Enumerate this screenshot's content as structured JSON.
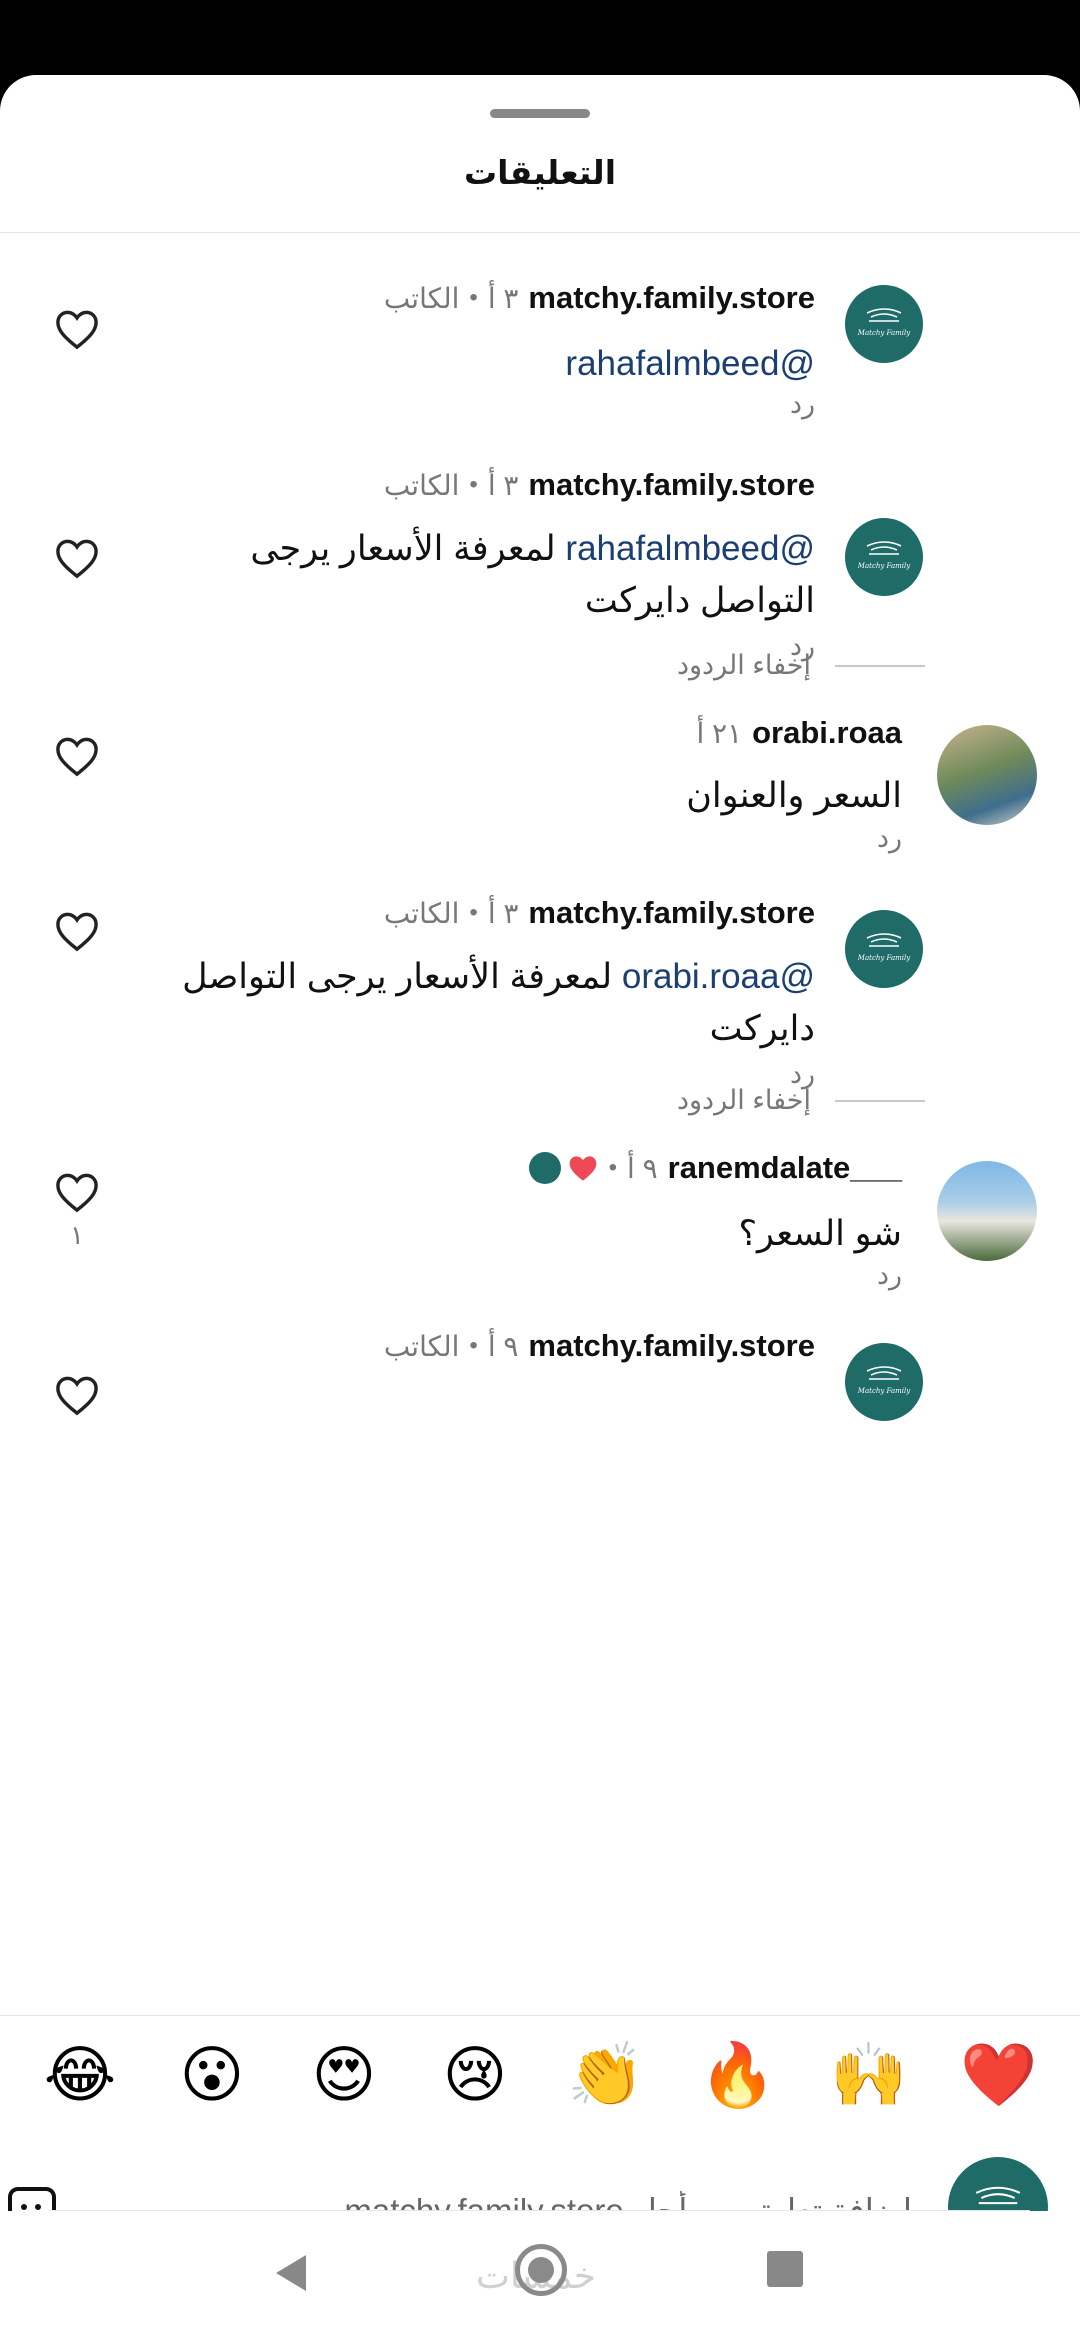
{
  "sheet": {
    "title": "التعليقات"
  },
  "comments": [
    {
      "username": "matchy.family.store",
      "time": "٣ أ",
      "author_badge": "الكاتب",
      "mention": "@rahafalmbeed",
      "text_line1": "",
      "text_line2": "",
      "reply": "رد"
    },
    {
      "username": "matchy.family.store",
      "time": "٣ أ",
      "author_badge": "الكاتب",
      "mention": "@rahafalmbeed",
      "text_line1": " لمعرفة الأسعار يرجى",
      "text_line2": "التواصل دايركت",
      "reply": "رد"
    },
    {
      "username": "orabi.roaa",
      "time": "٢١ أ",
      "text_line1": "السعر والعنوان",
      "reply": "رد"
    },
    {
      "username": "matchy.family.store",
      "time": "٣ أ",
      "author_badge": "الكاتب",
      "mention": "@orabi.roaa",
      "text_line1": " لمعرفة الأسعار يرجى التواصل",
      "text_line2": "دايركت",
      "reply": "رد"
    },
    {
      "username": "___ranemdalate",
      "time": "٩ أ",
      "text_line1": "شو السعر؟",
      "reply": "رد",
      "like_count": "١"
    },
    {
      "username": "matchy.family.store",
      "time": "٩ أ",
      "author_badge": "الكاتب"
    }
  ],
  "hide_replies": "إخفاء الردود",
  "emoji_bar": [
    "😂",
    "😮",
    "😍",
    "😢",
    "👏",
    "🔥",
    "🙌",
    "❤️"
  ],
  "composer": {
    "placeholder": "إضافة تعليق من أجل matchy.family.store..."
  },
  "navbar": {
    "watermark": "خمسات"
  },
  "colors": {
    "brand_teal": "#1e6b68",
    "mention_blue": "#1b3f73",
    "like_red": "#ed4956"
  }
}
